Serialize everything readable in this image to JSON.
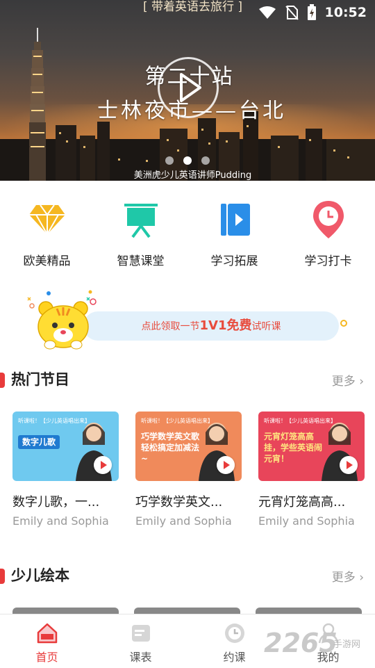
{
  "status_bar": {
    "title": "[ 带着英语去旅行 ]",
    "time": "10:52"
  },
  "banner": {
    "title_line1": "第二十站",
    "title_line2": "士林夜市——台北",
    "caption": "美洲虎少儿英语讲师Pudding",
    "dots": 3,
    "active_dot": 1
  },
  "features": [
    {
      "label": "欧美精品",
      "icon": "diamond-icon",
      "color": "#f5b721"
    },
    {
      "label": "智慧课堂",
      "icon": "presentation-board-icon",
      "color": "#1fc8a8"
    },
    {
      "label": "学习拓展",
      "icon": "video-book-icon",
      "color": "#2a8ee8"
    },
    {
      "label": "学习打卡",
      "icon": "clock-pin-icon",
      "color": "#f0596a"
    }
  ],
  "promo": {
    "text_pre": "点此领取一节",
    "text_bold": "1V1免费",
    "text_post": "试听课"
  },
  "sections": {
    "hot": {
      "title": "热门节目",
      "more": "更多"
    },
    "picture_books": {
      "title": "少儿绘本",
      "more": "更多"
    }
  },
  "hot_cards": [
    {
      "title": "数字儿歌，一...",
      "subtitle": "Emily and Sophia",
      "thumb_tag": "听课啦！【少儿英语唱出来】",
      "thumb_headline": "数字儿歌",
      "thumb_color": "#6fc9ef"
    },
    {
      "title": "巧学数学英文...",
      "subtitle": "Emily and Sophia",
      "thumb_tag": "听课啦！【少儿英语唱出来】",
      "thumb_headline": "巧学数学英文歌 轻松搞定加减法~",
      "thumb_color": "#f08a5b"
    },
    {
      "title": "元宵灯笼高高...",
      "subtitle": "Emily and Sophia",
      "thumb_tag": "听课啦！【少儿英语唱出来】",
      "thumb_headline": "元宵灯笼高高挂，学些英语闹元宵！",
      "thumb_color": "#e8455a"
    }
  ],
  "bottom_nav": [
    {
      "label": "首页",
      "icon": "home-icon",
      "active": true
    },
    {
      "label": "课表",
      "icon": "schedule-icon",
      "active": false
    },
    {
      "label": "约课",
      "icon": "clock-icon",
      "active": false
    },
    {
      "label": "我的",
      "icon": "user-icon",
      "active": false
    }
  ],
  "watermark": {
    "number": "2265",
    "text": "手游网"
  },
  "colors": {
    "accent": "#e83b3b",
    "muted": "#999999"
  }
}
